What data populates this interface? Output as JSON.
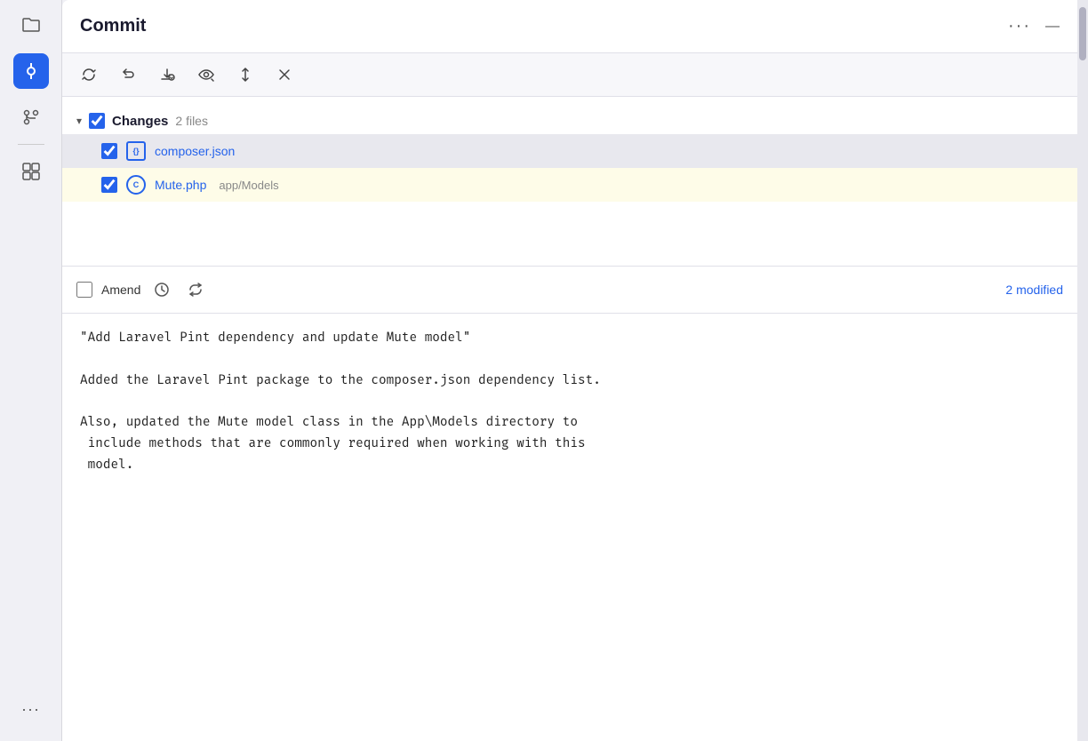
{
  "title": "Commit",
  "titlebar": {
    "title": "Commit",
    "dots_menu": "···",
    "minimize": "—"
  },
  "toolbar": {
    "icons": [
      "refresh",
      "undo",
      "download",
      "eye",
      "arrows-up-down",
      "close"
    ]
  },
  "changes": {
    "label": "Changes",
    "count": "2 files",
    "files": [
      {
        "name": "composer.json",
        "path": "",
        "type": "json",
        "icon_label": "{}",
        "selected": true
      },
      {
        "name": "Mute.php",
        "path": "app/Models",
        "type": "php",
        "icon_label": "C",
        "selected": false
      }
    ]
  },
  "amend": {
    "label": "Amend",
    "modified_text": "2 modified"
  },
  "commit_message": "\"Add Laravel Pint dependency and update Mute model\"\n\nAdded the Laravel Pint package to the composer.json dependency list.\n\nAlso, updated the Mute model class in the App\\Models directory to\n include methods that are commonly required when working with this\n model."
}
